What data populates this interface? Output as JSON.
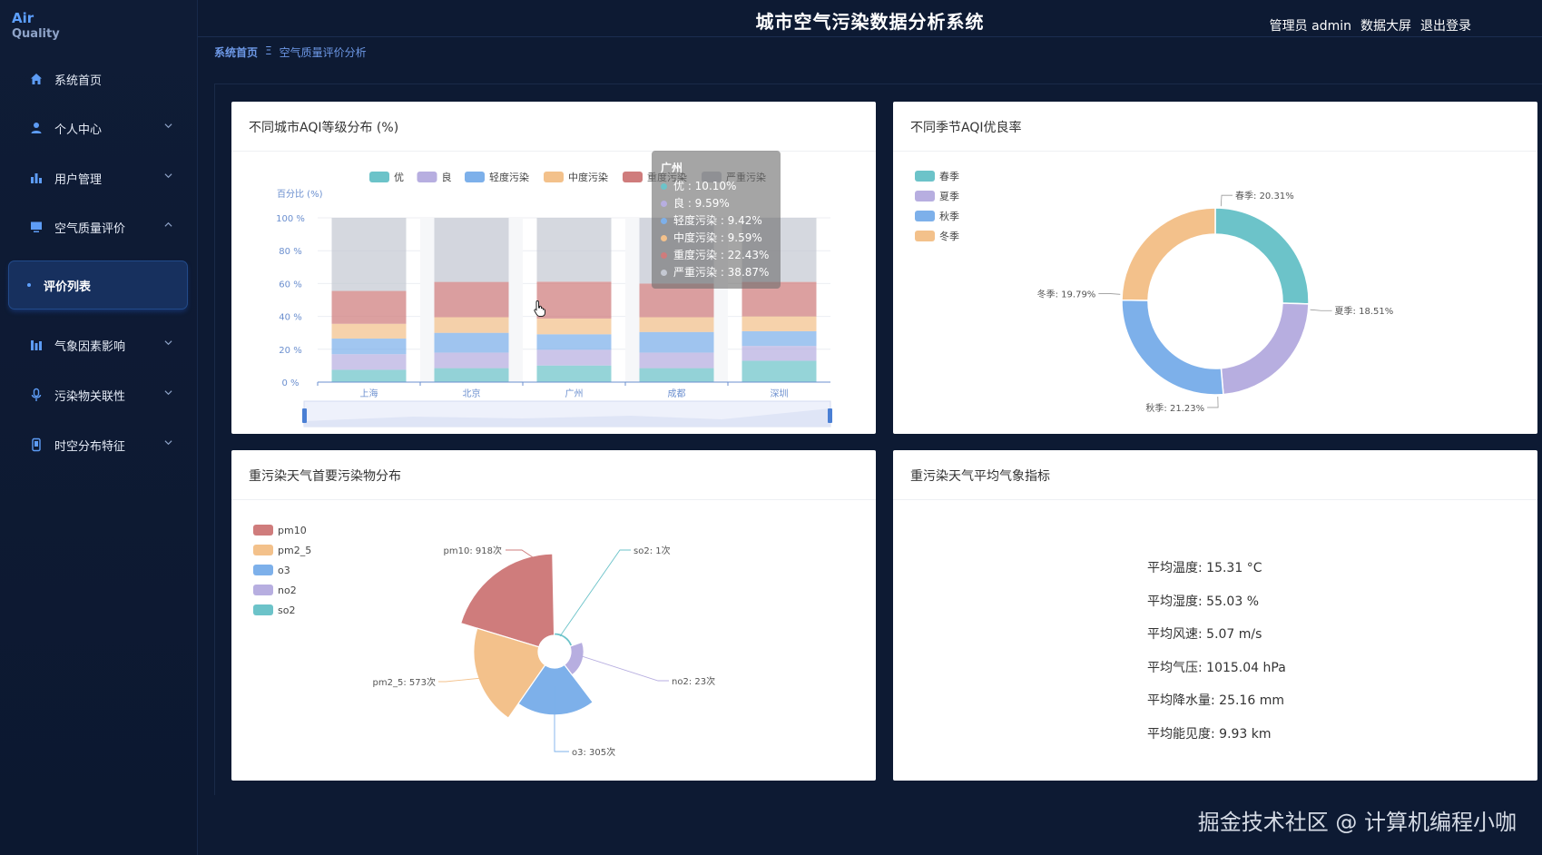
{
  "app": {
    "logo_line1": "Air",
    "logo_line2": "Quality",
    "title": "城市空气污染数据分析系统"
  },
  "header": {
    "user": "管理员 admin",
    "dashboard": "数据大屏",
    "logout": "退出登录"
  },
  "breadcrumb": {
    "home": "系统首页",
    "sep": "Ξ",
    "current": "空气质量评价分析"
  },
  "sidebar": {
    "items": [
      {
        "label": "系统首页",
        "icon": "home-icon"
      },
      {
        "label": "个人中心",
        "icon": "user-icon"
      },
      {
        "label": "用户管理",
        "icon": "bar-chart-icon"
      },
      {
        "label": "空气质量评价",
        "icon": "monitor-icon"
      },
      {
        "label": "气象因素影响",
        "icon": "column-chart-icon"
      },
      {
        "label": "污染物关联性",
        "icon": "microphone-icon"
      },
      {
        "label": "时空分布特征",
        "icon": "phone-icon"
      }
    ],
    "sub_active": "评价列表"
  },
  "cards": {
    "c1_title": "不同城市AQI等级分布 (%)",
    "c2_title": "不同季节AQI优良率",
    "c3_title": "重污染天气首要污染物分布",
    "c4_title": "重污染天气平均气象指标"
  },
  "tooltip": {
    "title": "广州",
    "rows": [
      {
        "text": "优 : 10.10%",
        "color": "#6cc3c9"
      },
      {
        "text": "良 : 9.59%",
        "color": "#b7aee0"
      },
      {
        "text": "轻度污染 : 9.42%",
        "color": "#7db0ea"
      },
      {
        "text": "中度污染 : 9.59%",
        "color": "#f3c18b"
      },
      {
        "text": "重度污染 : 22.43%",
        "color": "#cf7c7c"
      },
      {
        "text": "严重污染 : 38.87%",
        "color": "#c5c9d3"
      }
    ]
  },
  "weather_stats": [
    "平均温度: 15.31 °C",
    "平均湿度: 55.03 %",
    "平均风速: 5.07 m/s",
    "平均气压: 1015.04 hPa",
    "平均降水量: 25.16 mm",
    "平均能见度: 9.93 km"
  ],
  "watermark": "掘金技术社区 @ 计算机编程小咖",
  "colors": {
    "excellent": "#6cc3c9",
    "good": "#b7aee0",
    "light": "#7db0ea",
    "moderate": "#f3c18b",
    "heavy": "#cf7c7c",
    "severe": "#c5c9d3"
  },
  "chart_data": [
    {
      "type": "bar",
      "stacked": true,
      "ylabel": "百分比 (%)",
      "ylim": [
        0,
        100
      ],
      "yticks": [
        "0 %",
        "20 %",
        "40 %",
        "60 %",
        "80 %",
        "100 %"
      ],
      "categories": [
        "上海",
        "北京",
        "广州",
        "成都",
        "深圳"
      ],
      "series": [
        {
          "name": "优",
          "values": [
            7.5,
            8.5,
            10.1,
            8.5,
            13.0
          ]
        },
        {
          "name": "良",
          "values": [
            9.5,
            9.5,
            9.59,
            9.5,
            9.0
          ]
        },
        {
          "name": "轻度污染",
          "values": [
            9.5,
            12.0,
            9.42,
            12.5,
            9.0
          ]
        },
        {
          "name": "中度污染",
          "values": [
            9.0,
            9.5,
            9.59,
            9.0,
            9.0
          ]
        },
        {
          "name": "重度污染",
          "values": [
            20.0,
            21.5,
            22.43,
            20.5,
            21.0
          ]
        },
        {
          "name": "严重污染",
          "values": [
            44.5,
            39.0,
            38.87,
            40.0,
            39.0
          ]
        }
      ]
    },
    {
      "type": "pie",
      "donut": true,
      "series_names": [
        "春季",
        "夏季",
        "秋季",
        "冬季"
      ],
      "values": [
        20.31,
        18.51,
        21.23,
        19.79
      ],
      "labels": [
        "春季: 20.31%",
        "夏季: 18.51%",
        "秋季: 21.23%",
        "冬季: 19.79%"
      ]
    },
    {
      "type": "pie",
      "rose": true,
      "series_names": [
        "pm10",
        "pm2_5",
        "o3",
        "no2",
        "so2"
      ],
      "values": [
        918,
        573,
        305,
        23,
        1
      ],
      "labels": [
        "pm10: 918次",
        "pm2_5: 573次",
        "o3: 305次",
        "no2: 23次",
        "so2: 1次"
      ]
    }
  ]
}
